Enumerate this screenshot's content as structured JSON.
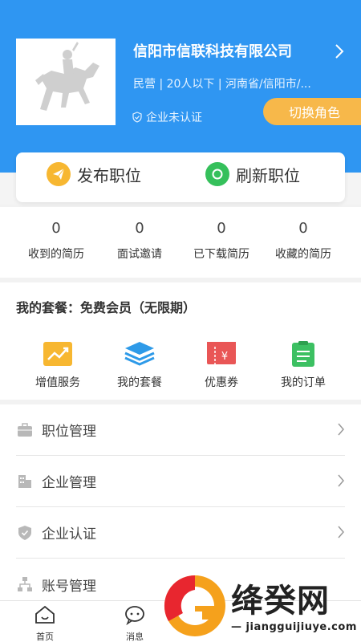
{
  "header": {
    "company_name": "信阳市信联科技有限公司",
    "company_meta": "民营 | 20人以下 | 河南省/信阳市/...",
    "certification_status": "企业未认证",
    "switch_role_label": "切换角色",
    "brand_color": "#2f96f2"
  },
  "actions": {
    "publish_label": "发布职位",
    "refresh_label": "刷新职位",
    "publish_icon": "paper-plane-icon",
    "refresh_icon": "refresh-icon"
  },
  "stats": [
    {
      "value": "0",
      "label": "收到的简历"
    },
    {
      "value": "0",
      "label": "面试邀请"
    },
    {
      "value": "0",
      "label": "已下载简历"
    },
    {
      "value": "0",
      "label": "收藏的简历"
    }
  ],
  "package": {
    "title": "我的套餐：免费会员（无限期）",
    "services": [
      {
        "label": "增值服务",
        "icon": "trend-chart-icon",
        "color": "#f7b731"
      },
      {
        "label": "我的套餐",
        "icon": "layers-icon",
        "color": "#2e9ae8"
      },
      {
        "label": "优惠券",
        "icon": "coupon-icon",
        "color": "#e95656"
      },
      {
        "label": "我的订单",
        "icon": "clipboard-icon",
        "color": "#3cc062"
      }
    ]
  },
  "menu": [
    {
      "label": "职位管理",
      "icon": "briefcase-icon"
    },
    {
      "label": "企业管理",
      "icon": "building-icon"
    },
    {
      "label": "企业认证",
      "icon": "shield-icon"
    },
    {
      "label": "账号管理",
      "icon": "org-chart-icon"
    }
  ],
  "tabbar": [
    {
      "label": "首页",
      "icon": "home-icon"
    },
    {
      "label": "消息",
      "icon": "chat-icon"
    }
  ],
  "watermark": {
    "text": "绛癸网",
    "url": "— jiangguijiuye.com —"
  }
}
